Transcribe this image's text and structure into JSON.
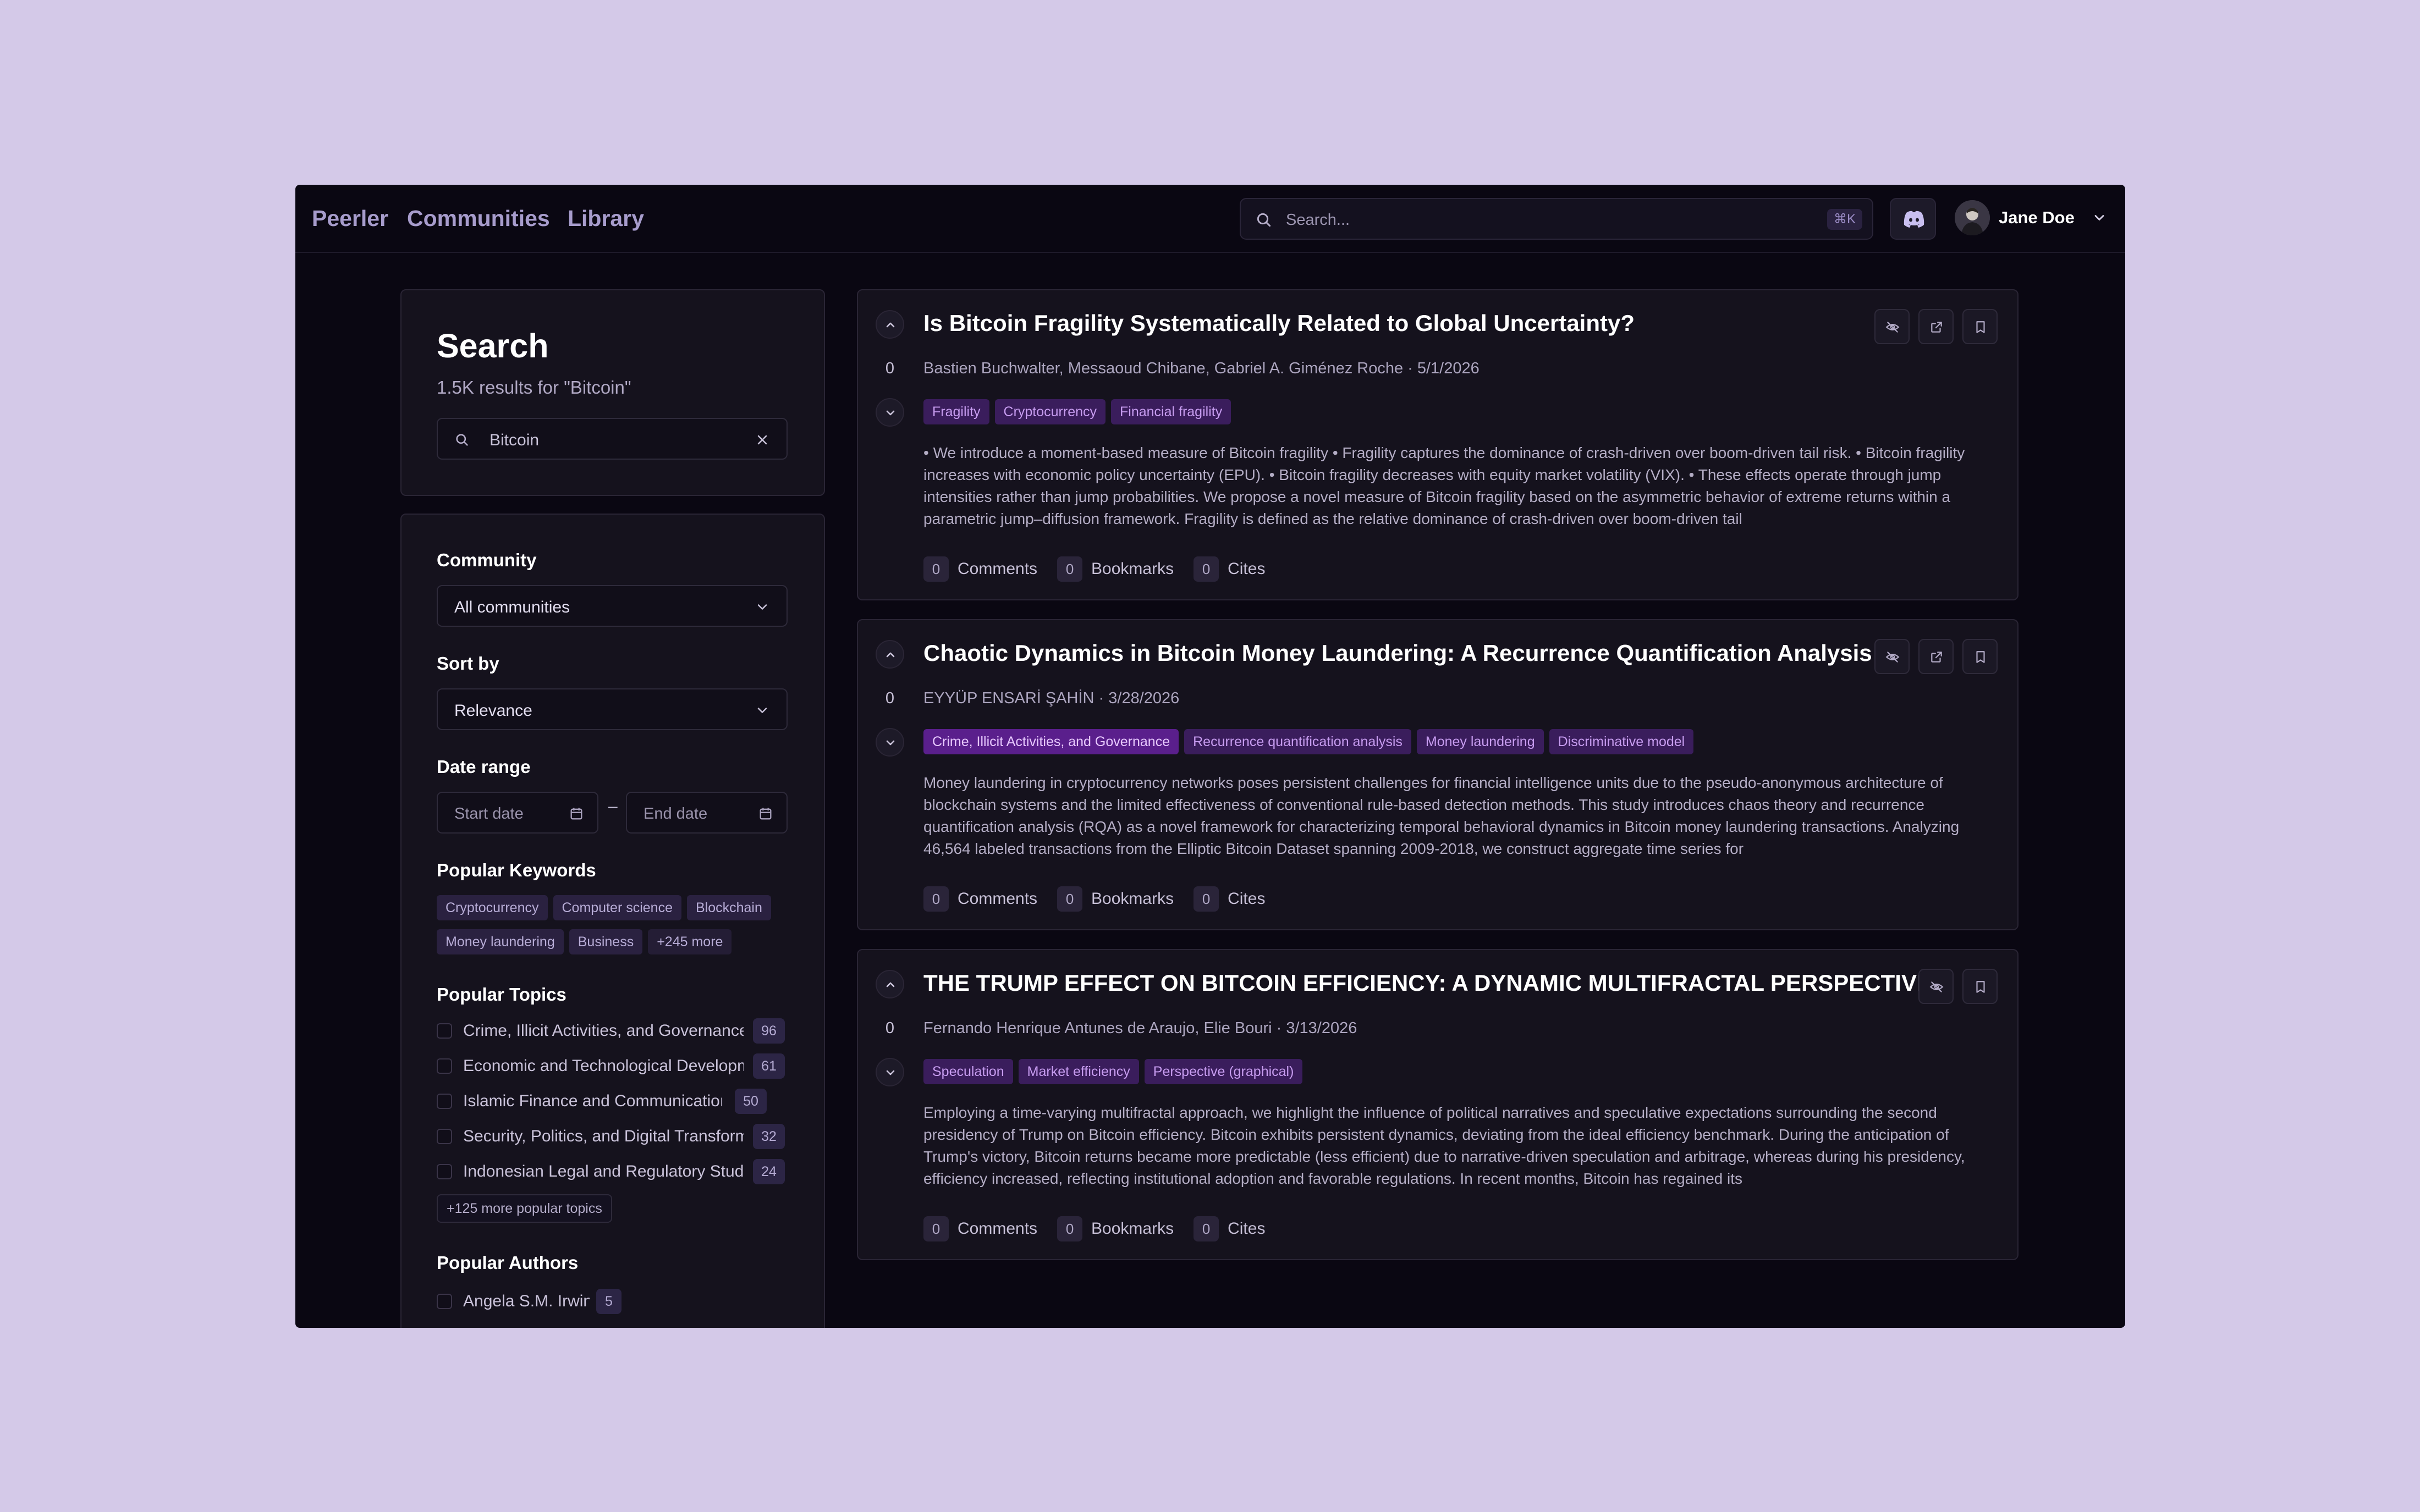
{
  "nav": {
    "brand": "Peerler",
    "communities": "Communities",
    "library": "Library"
  },
  "header_search": {
    "placeholder": "Search...",
    "shortcut": "⌘K"
  },
  "user": {
    "name": "Jane Doe"
  },
  "search_panel": {
    "title": "Search",
    "summary": "1.5K results for \"Bitcoin\"",
    "query": "Bitcoin"
  },
  "filters": {
    "community_label": "Community",
    "community_value": "All communities",
    "sort_label": "Sort by",
    "sort_value": "Relevance",
    "date_label": "Date range",
    "start_placeholder": "Start date",
    "date_separator": "–",
    "end_placeholder": "End date",
    "keywords_label": "Popular Keywords",
    "keywords": [
      "Cryptocurrency",
      "Computer science",
      "Blockchain",
      "Money laundering",
      "Business",
      "+245 more"
    ],
    "topics_label": "Popular Topics",
    "topics": [
      {
        "label": "Crime, Illicit Activities, and Governance",
        "count": "96"
      },
      {
        "label": "Economic and Technological Development",
        "count": "61"
      },
      {
        "label": "Islamic Finance and Communication",
        "count": "50"
      },
      {
        "label": "Security, Politics, and Digital Transformation",
        "count": "32"
      },
      {
        "label": "Indonesian Legal and Regulatory Studies",
        "count": "24"
      }
    ],
    "more_topics": "+125 more popular topics",
    "authors_label": "Popular Authors",
    "authors": [
      {
        "label": "Angela S.M. Irwin",
        "count": "5"
      }
    ]
  },
  "results": [
    {
      "title": "Is Bitcoin Fragility Systematically Related to Global Uncertainty?",
      "votes": "0",
      "meta": "Bastien Buchwalter, Messaoud Chibane, Gabriel A. Giménez Roche · 5/1/2026",
      "tags": [
        "Fragility",
        "Cryptocurrency",
        "Financial fragility"
      ],
      "abstract": "• We introduce a moment-based measure of Bitcoin fragility • Fragility captures the dominance of crash-driven over boom-driven tail risk. • Bitcoin fragility increases with economic policy uncertainty (EPU). • Bitcoin fragility decreases with equity market volatility (VIX). • These effects operate through jump intensities rather than jump probabilities. We propose a novel measure of Bitcoin fragility based on the asymmetric behavior of extreme returns within a parametric jump–diffusion framework. Fragility is defined as the relative dominance of crash-driven over boom-driven tail",
      "comments": "0",
      "bookmarks": "0",
      "cites": "0"
    },
    {
      "title": "Chaotic Dynamics in Bitcoin Money Laundering: A Recurrence Quantification Analysis",
      "votes": "0",
      "meta": "EYYÜP ENSARİ ŞAHİN · 3/28/2026",
      "tags": [
        "Crime, Illicit Activities, and Governance",
        "Recurrence quantification analysis",
        "Money laundering",
        "Discriminative model"
      ],
      "abstract": "Money laundering in cryptocurrency networks poses persistent challenges for financial intelligence units due to the pseudo-anonymous architecture of blockchain systems and the limited effectiveness of conventional rule-based detection methods. This study introduces chaos theory and recurrence quantification analysis (RQA) as a novel framework for characterizing temporal behavioral dynamics in Bitcoin money laundering transactions. Analyzing 46,564 labeled transactions from the Elliptic Bitcoin Dataset spanning 2009-2018, we construct aggregate time series for",
      "comments": "0",
      "bookmarks": "0",
      "cites": "0"
    },
    {
      "title": "THE TRUMP EFFECT ON BITCOIN EFFICIENCY: A DYNAMIC MULTIFRACTAL PERSPECTIVE",
      "votes": "0",
      "meta": "Fernando Henrique Antunes de Araujo, Elie Bouri · 3/13/2026",
      "tags": [
        "Speculation",
        "Market efficiency",
        "Perspective (graphical)"
      ],
      "abstract": "Employing a time-varying multifractal approach, we highlight the influence of political narratives and speculative expectations surrounding the second presidency of Trump on Bitcoin efficiency. Bitcoin exhibits persistent dynamics, deviating from the ideal efficiency benchmark. During the anticipation of Trump's victory, Bitcoin returns became more predictable (less efficient) due to narrative-driven speculation and arbitrage, whereas during his presidency, efficiency increased, reflecting institutional adoption and favorable regulations. In recent months, Bitcoin has regained its",
      "comments": "0",
      "bookmarks": "0",
      "cites": "0"
    }
  ],
  "stat_labels": {
    "comments": "Comments",
    "bookmarks": "Bookmarks",
    "cites": "Cites"
  },
  "colors": {
    "page_bg": "#d4c9e8",
    "app_bg": "#0a0712",
    "panel_bg": "#15121d",
    "accent": "#a79ccc",
    "tag_bg": "#3a1d5c",
    "tag_text": "#c79cf0"
  }
}
